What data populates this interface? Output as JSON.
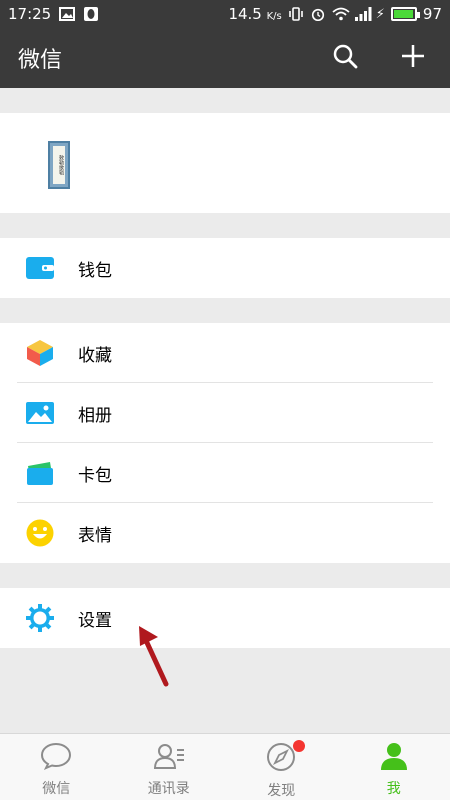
{
  "status": {
    "time": "17:25",
    "speed": "14.5",
    "speed_unit": "K/s",
    "battery": "97",
    "battery_level": 0.97
  },
  "header": {
    "title": "微信",
    "search_icon": "search-icon",
    "add_icon": "plus-icon"
  },
  "profile": {
    "avatar_text": "敕勒歌辑"
  },
  "menu": {
    "wallet": {
      "label": "钱包",
      "icon": "wallet-icon"
    },
    "favorites": {
      "label": "收藏",
      "icon": "cube-icon"
    },
    "album": {
      "label": "相册",
      "icon": "photo-icon"
    },
    "cards": {
      "label": "卡包",
      "icon": "card-icon"
    },
    "stickers": {
      "label": "表情",
      "icon": "smile-icon"
    },
    "settings": {
      "label": "设置",
      "icon": "gear-icon"
    }
  },
  "tabs": [
    {
      "label": "微信",
      "icon": "chat-icon"
    },
    {
      "label": "通讯录",
      "icon": "contacts-icon"
    },
    {
      "label": "发现",
      "icon": "compass-icon"
    },
    {
      "label": "我",
      "icon": "person-icon"
    }
  ],
  "colors": {
    "header_bg": "#3a3a3a",
    "accent_green": "#45c01a",
    "icon_blue": "#1aaded",
    "badge_red": "#f43530",
    "annotation_arrow": "#b0191e"
  }
}
